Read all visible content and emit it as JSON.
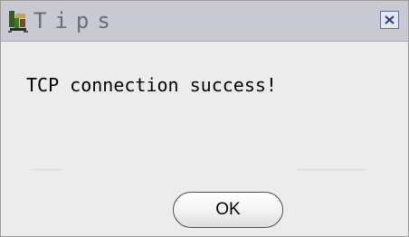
{
  "dialog": {
    "title": "Tips",
    "icon": "app-figure-icon",
    "close_icon": "close-x-icon",
    "message": "TCP connection success!",
    "ok_label": "OK"
  },
  "colors": {
    "titlebar": "#c9c9d4",
    "title_text": "#6d6d7a",
    "body": "#ececec",
    "close_border": "#5b6f9a"
  }
}
